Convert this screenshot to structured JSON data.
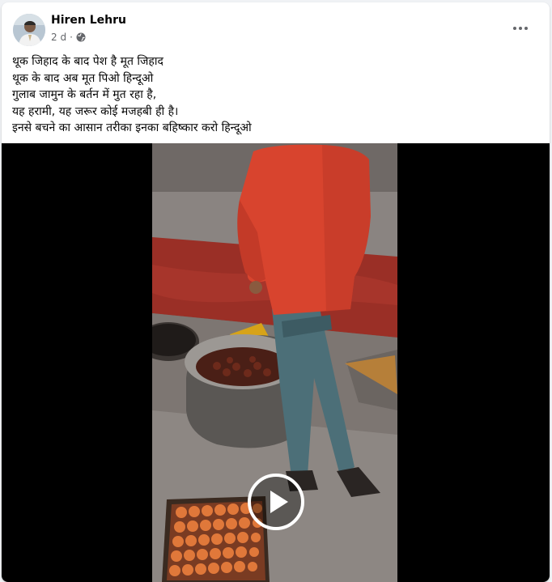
{
  "post": {
    "author": "Hiren Lehru",
    "time": "2 d",
    "separator": "·",
    "audience_icon": "globe-icon",
    "more_icon": "more-options-icon",
    "caption_lines": [
      "थूक जिहाद के बाद पेश है मूत जिहाद",
      "थूक के बाद अब मूत पिओ हिन्दूओ",
      "गुलाब जामुन के बर्तन में मुत रहा है,",
      "यह हरामी, यह जरूर कोई मजहबी ही है।",
      "इनसे बचने का आसान तरीका इनका बहिष्कार करो हिन्दूओ"
    ]
  },
  "video": {
    "play_icon": "play-icon"
  },
  "colors": {
    "name": "#050505",
    "meta": "#65676b",
    "card": "#ffffff",
    "background": "#f0f2f5"
  }
}
